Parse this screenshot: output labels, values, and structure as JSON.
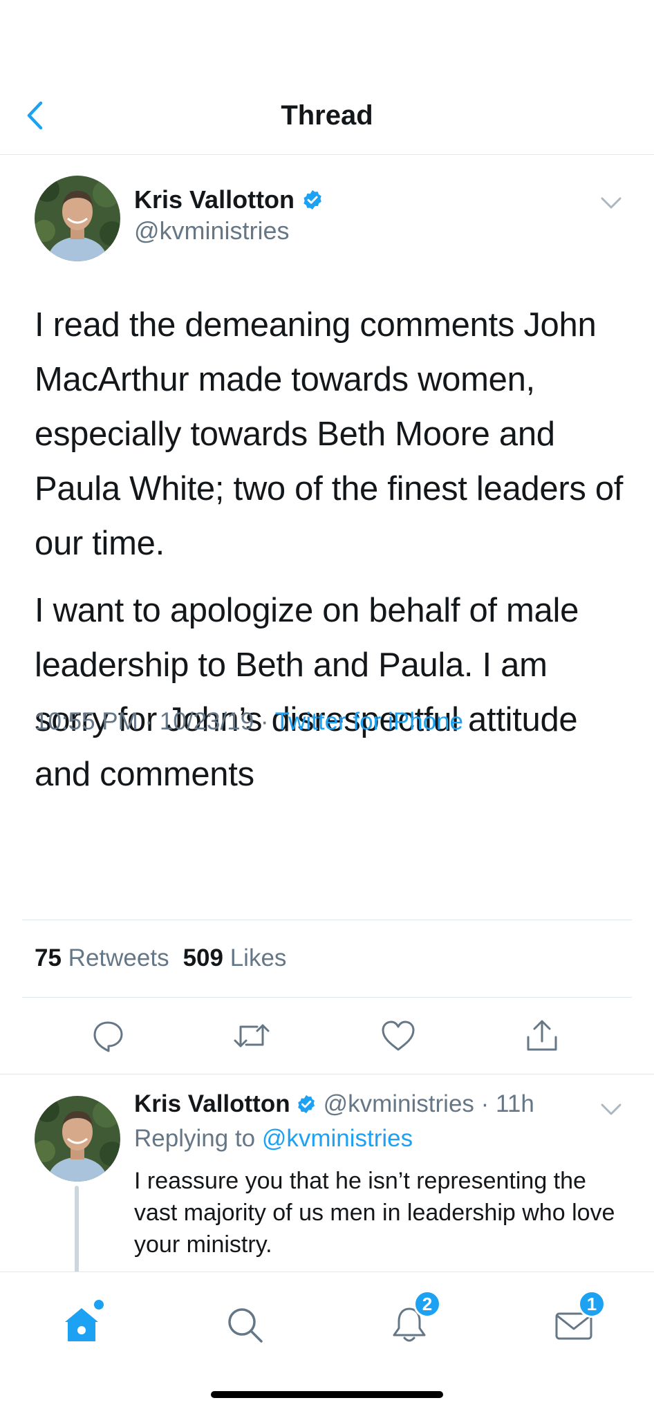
{
  "header": {
    "title": "Thread"
  },
  "tweet": {
    "author_name": "Kris Vallotton",
    "handle": "@kvministries",
    "paragraphs": [
      "I read the demeaning comments John MacArthur made towards women, especially towards Beth Moore and Paula White; two of the finest leaders of our time.",
      "I want to apologize on behalf of male leadership to Beth and Paula. I am sorry for John’s disrespectful attitude and comments"
    ],
    "time": "10:55 PM · 10/23/19 · ",
    "source": "Twitter for iPhone",
    "retweet_count": "75",
    "retweet_label": "Retweets",
    "like_count": "509",
    "like_label": "Likes"
  },
  "reply": {
    "author_name": "Kris Vallotton",
    "handle_time": "@kvministries · 11h",
    "replying_label": "Replying to ",
    "replying_to": "@kvministries",
    "text": "I reassure you that he isn’t representing the vast majority of us men in leadership who love your ministry."
  },
  "tabbar": {
    "notifications_badge": "2",
    "messages_badge": "1"
  },
  "colors": {
    "accent": "#1da1f2",
    "text": "#14171a",
    "secondary": "#657786",
    "divider": "#e1e8ed"
  },
  "icons": [
    "chevron-left-icon",
    "verified-icon",
    "chevron-down-icon",
    "reply-icon",
    "retweet-icon",
    "like-icon",
    "share-icon",
    "home-icon",
    "search-icon",
    "notifications-icon",
    "messages-icon"
  ]
}
